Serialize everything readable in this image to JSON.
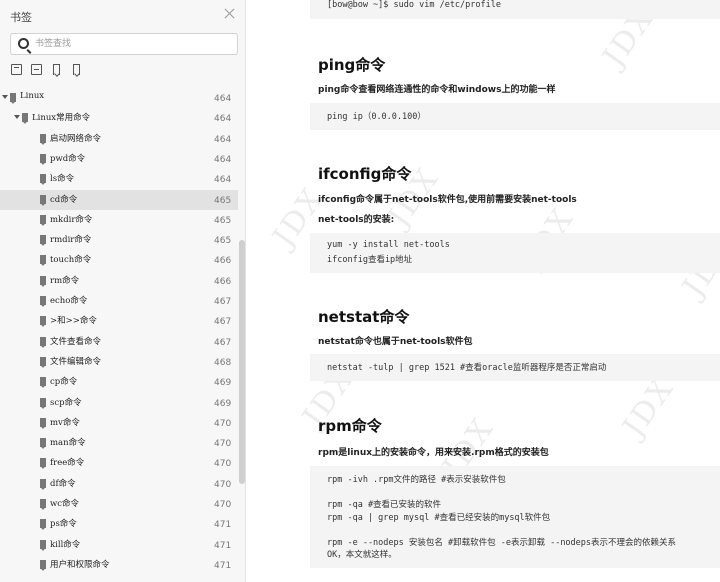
{
  "sidebar": {
    "title": "书签",
    "search_placeholder": "书签查找",
    "toolbar_icons": [
      "expand-all-icon",
      "collapse-all-icon",
      "add-bookmark-icon",
      "bookmark-icon"
    ],
    "items": [
      {
        "label": "Linux",
        "page": "464",
        "level": 0,
        "expandable": true,
        "selected": false
      },
      {
        "label": "Linux常用命令",
        "page": "464",
        "level": 1,
        "expandable": true,
        "selected": false
      },
      {
        "label": "启动网络命令",
        "page": "464",
        "level": 2,
        "expandable": false,
        "selected": false
      },
      {
        "label": "pwd命令",
        "page": "464",
        "level": 2,
        "expandable": false,
        "selected": false
      },
      {
        "label": "ls命令",
        "page": "464",
        "level": 2,
        "expandable": false,
        "selected": false
      },
      {
        "label": "cd命令",
        "page": "465",
        "level": 2,
        "expandable": false,
        "selected": true
      },
      {
        "label": "mkdir命令",
        "page": "465",
        "level": 2,
        "expandable": false,
        "selected": false
      },
      {
        "label": "rmdir命令",
        "page": "465",
        "level": 2,
        "expandable": false,
        "selected": false
      },
      {
        "label": "touch命令",
        "page": "466",
        "level": 2,
        "expandable": false,
        "selected": false
      },
      {
        "label": "rm命令",
        "page": "466",
        "level": 2,
        "expandable": false,
        "selected": false
      },
      {
        "label": "echo命令",
        "page": "467",
        "level": 2,
        "expandable": false,
        "selected": false
      },
      {
        "label": ">和>>命令",
        "page": "467",
        "level": 2,
        "expandable": false,
        "selected": false
      },
      {
        "label": "文件查看命令",
        "page": "467",
        "level": 2,
        "expandable": false,
        "selected": false
      },
      {
        "label": "文件编辑命令",
        "page": "468",
        "level": 2,
        "expandable": false,
        "selected": false
      },
      {
        "label": "cp命令",
        "page": "469",
        "level": 2,
        "expandable": false,
        "selected": false
      },
      {
        "label": "scp命令",
        "page": "469",
        "level": 2,
        "expandable": false,
        "selected": false
      },
      {
        "label": "mv命令",
        "page": "470",
        "level": 2,
        "expandable": false,
        "selected": false
      },
      {
        "label": "man命令",
        "page": "470",
        "level": 2,
        "expandable": false,
        "selected": false
      },
      {
        "label": "free命令",
        "page": "470",
        "level": 2,
        "expandable": false,
        "selected": false
      },
      {
        "label": "df命令",
        "page": "470",
        "level": 2,
        "expandable": false,
        "selected": false
      },
      {
        "label": "wc命令",
        "page": "470",
        "level": 2,
        "expandable": false,
        "selected": false
      },
      {
        "label": "ps命令",
        "page": "471",
        "level": 2,
        "expandable": false,
        "selected": false
      },
      {
        "label": "kill命令",
        "page": "471",
        "level": 2,
        "expandable": false,
        "selected": false
      },
      {
        "label": "用户和权限命令",
        "page": "471",
        "level": 2,
        "expandable": false,
        "selected": false
      }
    ]
  },
  "document": {
    "watermark": "JDX",
    "top_code": [
      "[bow@bow ~]$ sudo vim /etc/profile"
    ],
    "sections": [
      {
        "heading": "ping命令",
        "paragraphs": [
          "ping命令查看网络连通性的命令和windows上的功能一样"
        ],
        "code": [
          "ping ip（0.0.0.100）"
        ]
      },
      {
        "heading": "ifconfig命令",
        "paragraphs": [
          "ifconfig命令属于net-tools软件包,使用前需要安装net-tools",
          "net-tools的安装:"
        ],
        "code": [
          "yum -y install net-tools",
          "ifconfig查看ip地址"
        ]
      },
      {
        "heading": "netstat命令",
        "paragraphs": [
          "netstat命令也属于net-tools软件包"
        ],
        "code": [
          "netstat -tulp | grep 1521 #查看oracle监听器程序是否正常启动"
        ]
      },
      {
        "heading": "rpm命令",
        "paragraphs": [
          "rpm是linux上的安装命令，用来安装.rpm格式的安装包"
        ],
        "code": [
          "rpm -ivh .rpm文件的路径 #表示安装软件包",
          "",
          "rpm -qa #查看已安装的软件",
          "rpm -qa | grep mysql #查看已经安装的mysql软件包",
          "",
          "rpm -e --nodeps 安装包名 #卸载软件包 -e表示卸载 --nodeps表示不理会的依赖关系",
          "OK，本文就这样。"
        ]
      }
    ]
  }
}
